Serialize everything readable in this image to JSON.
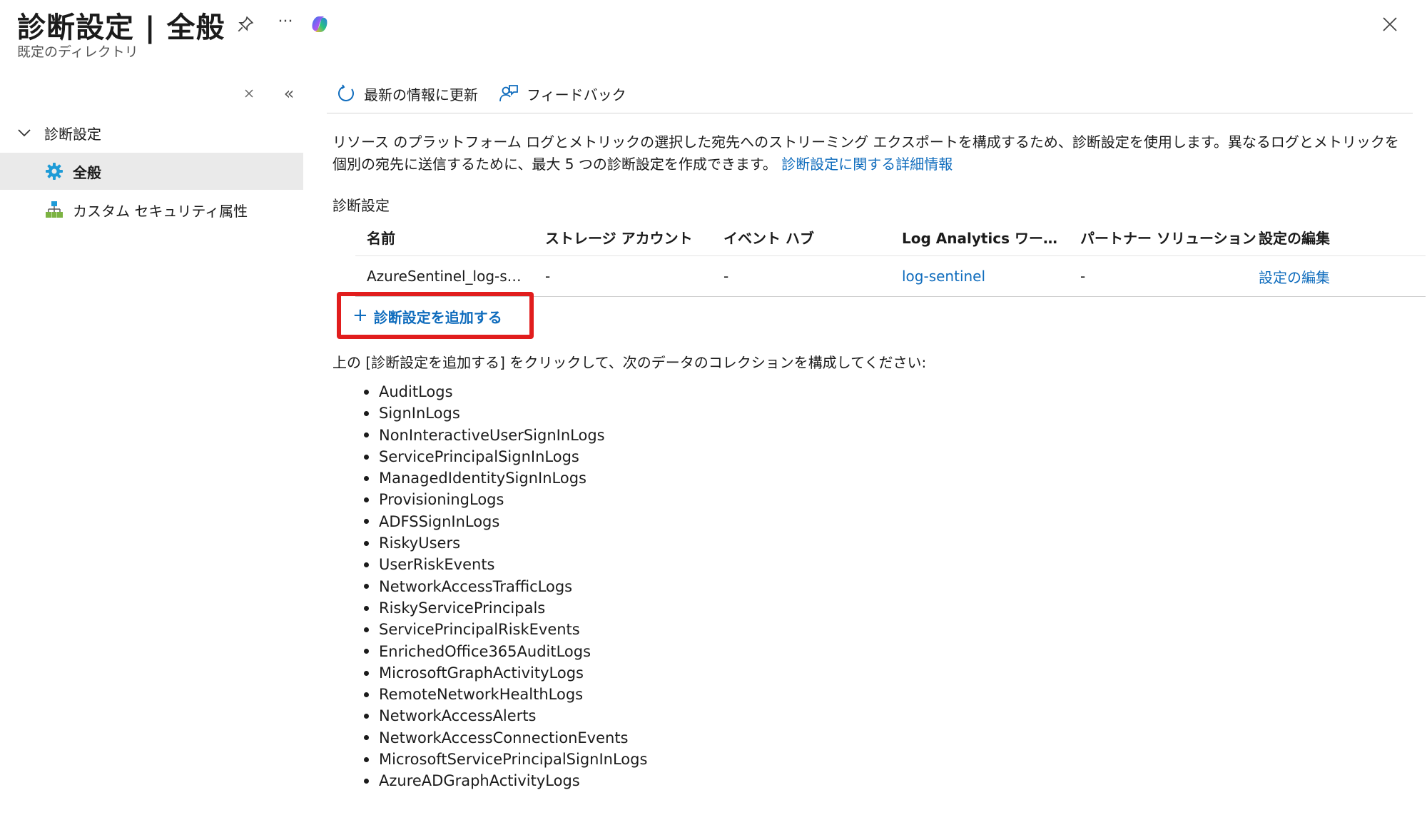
{
  "header": {
    "title": "診断設定 | 全般",
    "subtitle": "既定のディレクトリ",
    "more_label": "···"
  },
  "sidebar": {
    "collapse_label": "«",
    "group_label": "診断設定",
    "items": [
      {
        "label": "全般",
        "icon": "gear-icon",
        "active": true
      },
      {
        "label": "カスタム セキュリティ属性",
        "icon": "hierarchy-icon",
        "active": false
      }
    ]
  },
  "toolbar": {
    "refresh_label": "最新の情報に更新",
    "feedback_label": "フィードバック"
  },
  "main": {
    "description": "リソース のプラットフォーム ログとメトリックの選択した宛先へのストリーミング エクスポートを構成するため、診断設定を使用します。異なるログとメトリックを個別の宛先に送信するために、最大 5 つの診断設定を作成できます。",
    "learn_more_link": "診断設定に関する詳細情報",
    "section_title": "診断設定",
    "table": {
      "headers": [
        "名前",
        "ストレージ アカウント",
        "イベント ハブ",
        "Log Analytics ワーク…",
        "パートナー ソリューション",
        "設定の編集"
      ],
      "rows": [
        [
          "AzureSentinel_log-s…",
          "-",
          "-",
          "log-sentinel",
          "-",
          "設定の編集"
        ]
      ]
    },
    "add_button_label": "診断設定を追加する",
    "instruction": "上の [診断設定を追加する] をクリックして、次のデータのコレクションを構成してください:",
    "logs": [
      "AuditLogs",
      "SignInLogs",
      "NonInteractiveUserSignInLogs",
      "ServicePrincipalSignInLogs",
      "ManagedIdentitySignInLogs",
      "ProvisioningLogs",
      "ADFSSignInLogs",
      "RiskyUsers",
      "UserRiskEvents",
      "NetworkAccessTrafficLogs",
      "RiskyServicePrincipals",
      "ServicePrincipalRiskEvents",
      "EnrichedOffice365AuditLogs",
      "MicrosoftGraphActivityLogs",
      "RemoteNetworkHealthLogs",
      "NetworkAccessAlerts",
      "NetworkAccessConnectionEvents",
      "MicrosoftServicePrincipalSignInLogs",
      "AzureADGraphActivityLogs"
    ]
  },
  "colors": {
    "link": "#0f6cbd",
    "highlight_border": "#e11d1d",
    "active_nav_bg": "#eaeaea"
  }
}
